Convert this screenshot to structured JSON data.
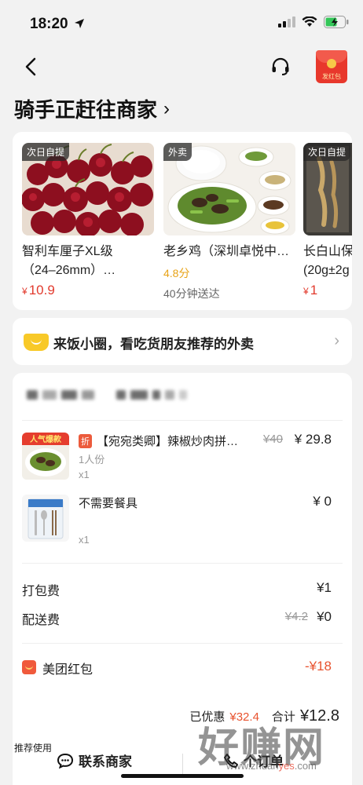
{
  "status": {
    "time": "18:20"
  },
  "nav": {
    "red_packet_label": "发红包"
  },
  "page": {
    "title": "骑手正赶往商家"
  },
  "recommendations": [
    {
      "tag": "次日自提",
      "name_line1": "智利车厘子XL级",
      "name_line2": "（24–26mm）…",
      "price_currency": "¥",
      "price": "10.9"
    },
    {
      "tag": "外卖",
      "name_line1": "老乡鸡（深圳卓悦中…",
      "rating": "4.8分",
      "eta": "40分钟送达"
    },
    {
      "tag": "次日自提",
      "name_line1": "长白山保",
      "name_line2": "(20g±2g",
      "price_currency": "¥",
      "price": "1"
    }
  ],
  "circle_banner": {
    "text": "来饭小圈，看吃货朋友推荐的外卖"
  },
  "order": {
    "items": [
      {
        "badge": "折",
        "title": "【宛宛类卿】辣椒炒肉拼…",
        "spec": "1人份",
        "qty": "x1",
        "orig_price": "¥40",
        "price": "¥ 29.8",
        "thumb_label": "人气爆款"
      },
      {
        "title": "不需要餐具",
        "qty": "x1",
        "price": "¥ 0"
      }
    ],
    "fees": {
      "packing_label": "打包费",
      "packing_value": "¥1",
      "delivery_label": "配送费",
      "delivery_orig": "¥4.2",
      "delivery_value": "¥0",
      "coupon_label": "美团红包",
      "coupon_value": "-¥18"
    },
    "total": {
      "discount_label": "已优惠",
      "discount_value": "¥32.4",
      "total_label": "合计",
      "total_value": "¥12.8"
    }
  },
  "bottom_bar": {
    "rec_use": "推荐使用",
    "contact_label": "联系商家",
    "right_label": "个订单"
  },
  "watermark": {
    "title": "好赚网",
    "url_prefix": "www.zhuan",
    "url_highlight": "yes",
    "url_suffix": ".com"
  },
  "colors": {
    "accent_red": "#e23b2e",
    "rating_orange": "#e8a317",
    "coupon_red": "#e8532f"
  }
}
